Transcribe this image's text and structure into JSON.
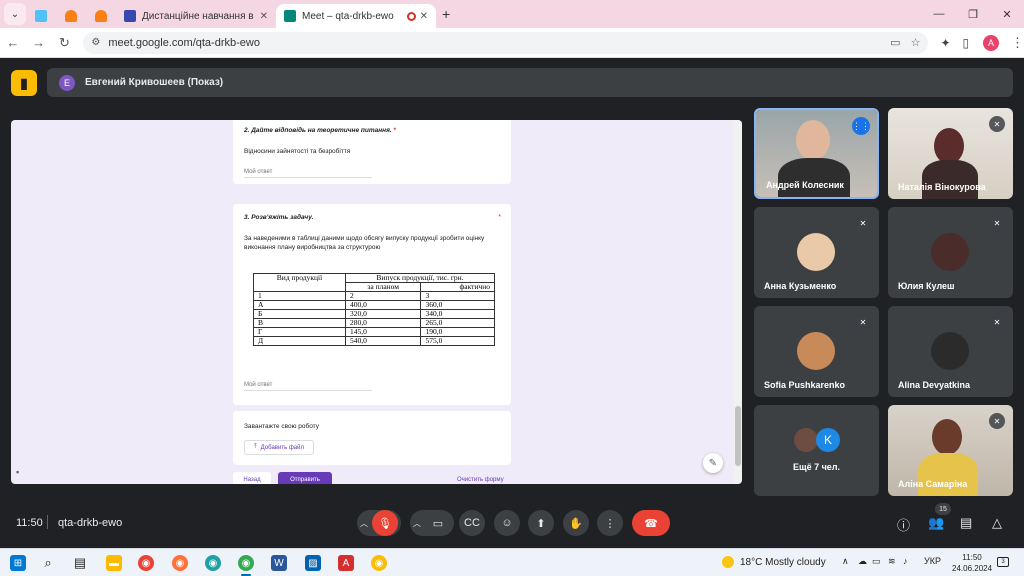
{
  "browser": {
    "tabs": [
      {
        "title": "",
        "icon": "form-icon",
        "color": "#4285f4"
      },
      {
        "title": "",
        "icon": "moodle-icon",
        "color": "#f98012"
      },
      {
        "title": "",
        "icon": "moodle-icon",
        "color": "#f98012"
      },
      {
        "title": "Дистанційне навчання в ВСП",
        "icon": "classroom-icon",
        "color": "#3949ab"
      },
      {
        "title": "Meet – qta-drkb-ewo",
        "icon": "meet-icon",
        "color": "#00897b"
      }
    ],
    "new_tab": "+",
    "url": "meet.google.com/qta-drkb-ewo",
    "profile_initial": "A"
  },
  "meet": {
    "presenter_initial": "E",
    "presenter_label": "Евгений Кривошеев (Показ)",
    "time": "11:50",
    "meeting_code": "qta-drkb-ewo",
    "participant_count": "15"
  },
  "form": {
    "q2": {
      "title": "2. Дайте відповідь на теоретичне питання.",
      "required": "*",
      "text": "Відносини зайнятості та безробіття",
      "answer_placeholder": "Мой ответ"
    },
    "q3": {
      "title": "3. Розв'яжіть задачу.",
      "required": "*",
      "text": "За наведеними в таблиці даними  щодо обсягу випуску продукції зробити оцінку виконання плану виробництва за структурою",
      "answer_placeholder": "Мой ответ",
      "table": {
        "col_product": "Вид продукції",
        "col_output": "Випуск продукції, тис. грн.",
        "sub_plan": "за планом",
        "sub_actual": "фактично",
        "rows": [
          [
            "1",
            "2",
            "3"
          ],
          [
            "А",
            "400,0",
            "360,0"
          ],
          [
            "Б",
            "320,0",
            "340,0"
          ],
          [
            "В",
            "280,0",
            "265,0"
          ],
          [
            "Г",
            "145,0",
            "190,0"
          ],
          [
            "Д",
            "540,0",
            "575,0"
          ]
        ]
      }
    },
    "upload": {
      "label": "Завантажте свою роботу",
      "button": "Добавить файл"
    },
    "back_button": "Назад",
    "submit_button": "Отправить",
    "clear_link": "Очистить форму"
  },
  "participants": [
    {
      "name": "Андрей Колесник"
    },
    {
      "name": "Наталія Вінокурова"
    },
    {
      "name": "Анна Кузьменко"
    },
    {
      "name": "Юлия Кулеш"
    },
    {
      "name": "Sofia Pushkarenko"
    },
    {
      "name": "Alina Devyatkina"
    },
    {
      "name": "Ещё 7 чел.",
      "initial": "K"
    },
    {
      "name": "Аліна Самаріна"
    }
  ],
  "taskbar": {
    "weather": "18°C  Mostly cloudy",
    "language": "УКР",
    "time": "11:50",
    "date": "24.06.2024"
  },
  "colors": {
    "meet_bg": "#202124",
    "tile_bg": "#3c4043",
    "form_accent": "#673ab7",
    "hangup": "#ea4335",
    "active_speaker": "#1a73e8"
  }
}
